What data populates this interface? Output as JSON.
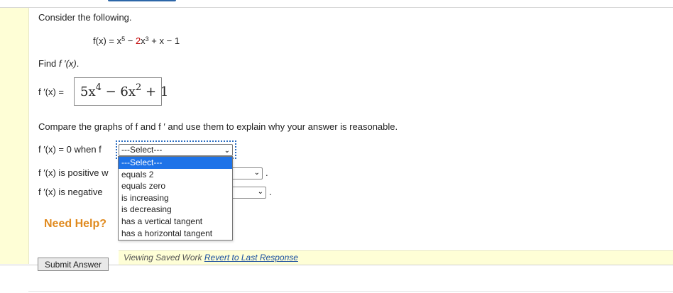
{
  "prompt": "Consider the following.",
  "function": {
    "lhs": "f(x) = x",
    "exp1": "5",
    "minus1": " − ",
    "coef": "2",
    "var": "x",
    "exp2": "3",
    "rest": " + x − 1"
  },
  "find": {
    "label": "Find ",
    "expr": "f ′(x)",
    "end": "."
  },
  "answer": {
    "label": "f ′(x) =",
    "part1": "5x",
    "exp1": "4",
    "part2": " − 6x",
    "exp2": "2",
    "part3": " + 1"
  },
  "compare_text": "Compare the graphs of f and f ′ and use them to explain why your answer is reasonable.",
  "rows": [
    {
      "label": "f ′(x) = 0 when f",
      "selected": "---Select---"
    },
    {
      "label": "f ′(x) is positive w",
      "end": "."
    },
    {
      "label": "f ′(x) is negative",
      "end": "."
    }
  ],
  "dropdown_options": [
    "---Select---",
    "equals 2",
    "equals zero",
    "is increasing",
    "is decreasing",
    "has a vertical tangent",
    "has a horizontal tangent"
  ],
  "need_help": "Need Help?",
  "saved": {
    "text": "Viewing Saved Work ",
    "link": "Revert to Last Response"
  },
  "submit_label": "Submit Answer"
}
